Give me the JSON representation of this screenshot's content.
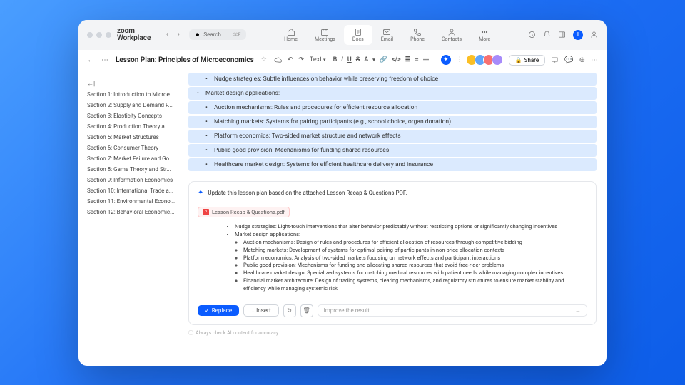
{
  "brand": "zoom\nWorkplace",
  "search": {
    "placeholder": "Search",
    "kbd": "⌘F"
  },
  "navtabs": [
    {
      "label": "Home"
    },
    {
      "label": "Meetings"
    },
    {
      "label": "Docs",
      "active": true
    },
    {
      "label": "Email"
    },
    {
      "label": "Phone"
    },
    {
      "label": "Contacts"
    },
    {
      "label": "More"
    }
  ],
  "crumb": "⋯",
  "doctitle": "Lesson Plan: Principles of Microeconomics",
  "text_label": "Text",
  "fmt": {
    "b": "B",
    "i": "I",
    "u": "U",
    "s": "S",
    "a": "A"
  },
  "share": "Share",
  "sections": [
    "Section 1: Introduction to Microe...",
    "Section 2: Supply and Demand F...",
    "Section 3: Elasticity Concepts",
    "Section 4: Production Theory a...",
    "Section 5: Market Structures",
    "Section 6: Consumer Theory",
    "Section 7: Market Failure and Go...",
    "Section 8: Game Theory and Str...",
    "Section 9: Information Economics",
    "Section 10: International Trade a...",
    "Section 11: Environmental Econo...",
    "Section 12: Behavioral Economic..."
  ],
  "doc": [
    {
      "sub": true,
      "text": "Nudge strategies: Subtle influences on behavior while preserving freedom of choice"
    },
    {
      "sub": false,
      "text": "Market design applications:"
    },
    {
      "sub": true,
      "text": "Auction mechanisms: Rules and procedures for efficient resource allocation"
    },
    {
      "sub": true,
      "text": "Matching markets: Systems for pairing participants (e.g., school choice, organ donation)"
    },
    {
      "sub": true,
      "text": "Platform economics: Two-sided market structure and network effects"
    },
    {
      "sub": true,
      "text": "Public good provision: Mechanisms for funding shared resources"
    },
    {
      "sub": true,
      "text": "Healthcare market design: Systems for efficient healthcare delivery and insurance"
    }
  ],
  "ai": {
    "prompt": "Update this lesson plan based on the attached Lesson Recap & Questions PDF.",
    "attachment": "Lesson Recap & Questions.pdf",
    "result": [
      {
        "t": "Nudge strategies: Light-touch interventions that alter behavior predictably without restricting options or significantly changing incentives",
        "c": []
      },
      {
        "t": "Market design applications:",
        "c": [
          "Auction mechanisms: Design of rules and procedures for efficient allocation of resources through competitive bidding",
          "Matching markets: Development of systems for optimal pairing of participants in non-price allocation contexts",
          "Platform economics: Analysis of two-sided markets focusing on network effects and participant interactions",
          "Public good provision: Mechanisms for funding and allocating shared resources that avoid free-rider problems",
          "Healthcare market design: Specialized systems for matching medical resources with patient needs while managing complex incentives",
          "Financial market architecture: Design of trading systems, clearing mechanisms, and regulatory structures to ensure market stability and efficiency while managing systemic risk"
        ]
      }
    ],
    "replace": "Replace",
    "insert": "Insert",
    "improve": "Improve the result...",
    "disclaimer": "Always check AI content for accuracy."
  }
}
